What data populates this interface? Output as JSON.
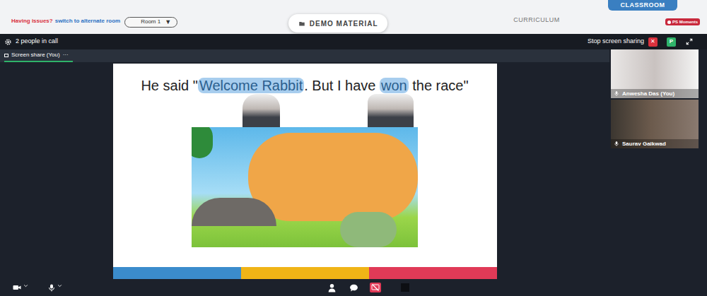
{
  "topbar": {
    "help_prefix": "Having issues?",
    "help_link": "switch to alternate room",
    "room": {
      "label": "Room 1",
      "arrow": "▼"
    },
    "demo_button": "DEMO MATERIAL",
    "nav": [
      {
        "label": "CURRICULUM",
        "selected": false
      },
      {
        "label": "CLASSROOM",
        "selected": true
      }
    ],
    "badge": "PS Moments"
  },
  "call": {
    "people": "2 people in call",
    "stop_share": "Stop screen sharing",
    "stop_icon": "✕",
    "avatar": "P",
    "share_tab": {
      "label": "Screen share (You)",
      "menu": "···",
      "selected": true
    }
  },
  "slide": {
    "segments": [
      {
        "text": "He said \"",
        "highlight": false
      },
      {
        "text": "Welcome Rabbit",
        "highlight": true
      },
      {
        "text": ". But I have ",
        "highlight": false
      },
      {
        "text": "won",
        "highlight": true
      },
      {
        "text": " the race\"",
        "highlight": false
      }
    ]
  },
  "participants": [
    {
      "name": "Anwesha Das (You)",
      "mic_on": true
    },
    {
      "name": "Saurav Gaikwad",
      "mic_on": true
    }
  ],
  "toolbar": {
    "screen_share_off": true
  }
}
